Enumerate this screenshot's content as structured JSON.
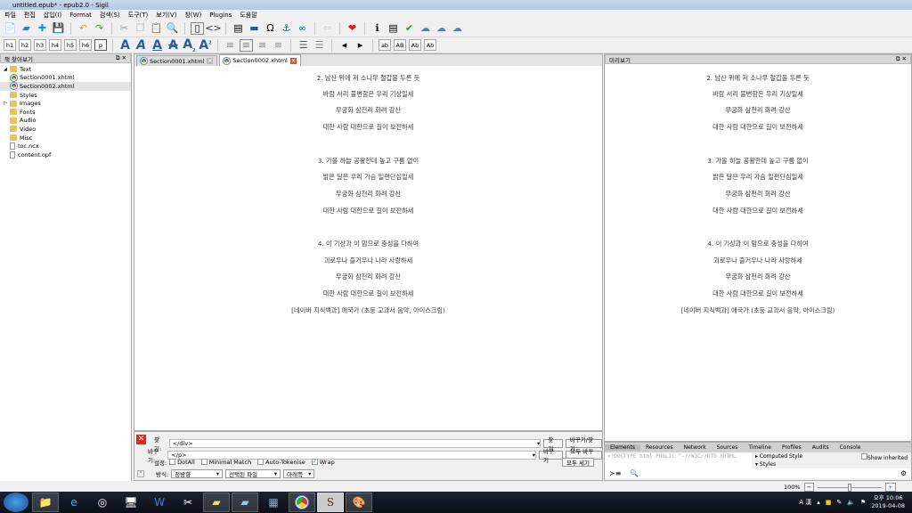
{
  "window": {
    "title": "untitled.epub* - epub2.0 - Sigil"
  },
  "menu": [
    "파일",
    "편집",
    "삽입(I)",
    "Format",
    "검색(S)",
    "도구(T)",
    "보기(V)",
    "창(W)",
    "Plugins",
    "도움말"
  ],
  "headings": [
    "h1",
    "h2",
    "h3",
    "h4",
    "h5",
    "h6",
    "p"
  ],
  "case_buttons": [
    "ab",
    "AB",
    "Ab",
    "Ab"
  ],
  "book_browser": {
    "title": "책 찾아보기",
    "items": [
      {
        "label": "Text",
        "type": "folder",
        "level": 0
      },
      {
        "label": "Section0001.xhtml",
        "type": "html",
        "level": 1
      },
      {
        "label": "Section0002.xhtml",
        "type": "html",
        "level": 1,
        "selected": true
      },
      {
        "label": "Styles",
        "type": "folder",
        "level": 0
      },
      {
        "label": "Images",
        "type": "folder",
        "level": 0
      },
      {
        "label": "Fonts",
        "type": "folder",
        "level": 0
      },
      {
        "label": "Audio",
        "type": "folder",
        "level": 0
      },
      {
        "label": "Video",
        "type": "folder",
        "level": 0
      },
      {
        "label": "Misc",
        "type": "folder",
        "level": 0
      },
      {
        "label": "toc.ncx",
        "type": "file",
        "level": 0
      },
      {
        "label": "content.opf",
        "type": "file",
        "level": 0
      }
    ]
  },
  "tabs": [
    {
      "label": "Section0001.xhtml",
      "active": false
    },
    {
      "label": "Section0002.xhtml",
      "active": true
    }
  ],
  "lyrics": [
    "2. 남산 위에 저 소나무 철갑을 두른 듯",
    "바람 서리 불변함은 우리 기상일세",
    "무궁화 삼천리 화려 강산",
    "대한 사람 대한으로 길이 보전하세",
    "3. 가을 하늘 공활한데 높고 구름 없이",
    "밝은 달은 우리 가슴 일편단심일세",
    "무궁화 삼천리 화려 강산",
    "대한 사람 대한으로 길이 보전하세",
    "4. 이 기상과 이 맘으로 충성을 다하여",
    "괴로우나 즐거우나 나라 사랑하세",
    "무궁화 삼천리 화려 강산",
    "대한 사람 대한으로 길이 보전하세",
    "[네이버 지식백과] 애국가 (초등 교과서 음악, 아이스크림)"
  ],
  "preview": {
    "title": "미리보기"
  },
  "find": {
    "find_label": "찾기:",
    "find_value": "</div>",
    "replace_label": "바꾸기:",
    "replace_value": "</p>",
    "options_label": "설정:",
    "options": [
      {
        "label": "DotAll",
        "checked": false
      },
      {
        "label": "Minimal Match",
        "checked": false
      },
      {
        "label": "Auto-Tokenise",
        "checked": false
      },
      {
        "label": "Wrap",
        "checked": true
      }
    ],
    "mode_label": "방식:",
    "mode": "정방향",
    "target": "선택된 파일",
    "direction": "아래쪽",
    "btn_find": "찾기",
    "btn_replace_find": "바꾸기/찾기",
    "btn_replace": "바꾸기",
    "btn_replace_all": "모두 바꾸기",
    "btn_count": "모두 세기"
  },
  "devtools": {
    "tabs": [
      "Elements",
      "Resources",
      "Network",
      "Sources",
      "Timeline",
      "Profiles",
      "Audits",
      "Console"
    ],
    "source": "<!DOCTYPE html PUBLIC \"-//W3C//DTD XHTML",
    "computed": "Computed Style",
    "styles": "Styles",
    "show_inherited": "Show inherited"
  },
  "zoom": "100%",
  "clock": {
    "ampm_time": "오후 10:06",
    "date": "2019-04-08"
  },
  "ime": "A 漢"
}
